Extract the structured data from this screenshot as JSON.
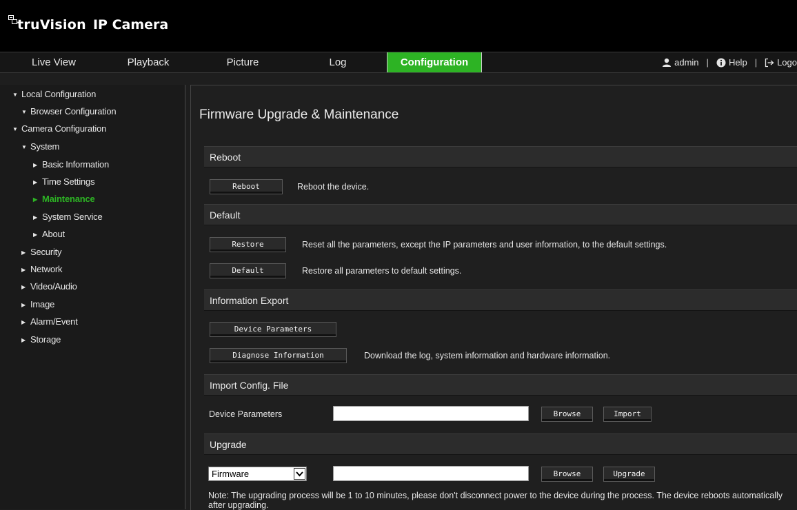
{
  "header": {
    "brand": "truVision",
    "product": "IP Camera"
  },
  "nav": {
    "tabs": [
      {
        "label": "Live View"
      },
      {
        "label": "Playback"
      },
      {
        "label": "Picture"
      },
      {
        "label": "Log"
      },
      {
        "label": "Configuration",
        "active": true
      }
    ],
    "user": "admin",
    "help": "Help",
    "logout": "Logo"
  },
  "sidebar": {
    "items": [
      {
        "label": "Local Configuration",
        "state": "expanded"
      },
      {
        "label": "Browser Configuration",
        "state": "expanded"
      },
      {
        "label": "Camera Configuration",
        "state": "expanded"
      },
      {
        "label": "System",
        "state": "expanded"
      },
      {
        "label": "Basic Information",
        "state": "collapsed"
      },
      {
        "label": "Time Settings",
        "state": "collapsed"
      },
      {
        "label": "Maintenance",
        "state": "collapsed",
        "selected": true
      },
      {
        "label": "System Service",
        "state": "collapsed"
      },
      {
        "label": "About",
        "state": "collapsed"
      },
      {
        "label": "Security",
        "state": "collapsed"
      },
      {
        "label": "Network",
        "state": "collapsed"
      },
      {
        "label": "Video/Audio",
        "state": "collapsed"
      },
      {
        "label": "Image",
        "state": "collapsed"
      },
      {
        "label": "Alarm/Event",
        "state": "collapsed"
      },
      {
        "label": "Storage",
        "state": "collapsed"
      }
    ]
  },
  "main": {
    "title": "Firmware Upgrade & Maintenance",
    "reboot": {
      "header": "Reboot",
      "button": "Reboot",
      "desc": "Reboot the device."
    },
    "default": {
      "header": "Default",
      "restore_button": "Restore",
      "restore_desc": "Reset all the parameters, except the IP parameters and user information, to the default settings.",
      "default_button": "Default",
      "default_desc": "Restore all parameters to default settings."
    },
    "export": {
      "header": "Information Export",
      "device_params_button": "Device Parameters",
      "diagnose_button": "Diagnose Information",
      "diagnose_desc": "Download the log, system information and hardware information."
    },
    "import": {
      "header": "Import Config. File",
      "label": "Device Parameters",
      "file_value": "",
      "browse_button": "Browse",
      "import_button": "Import"
    },
    "upgrade": {
      "header": "Upgrade",
      "type_value": "Firmware",
      "file_value": "",
      "browse_button": "Browse",
      "upgrade_button": "Upgrade",
      "note": "Note: The upgrading process will be 1 to 10 minutes, please don't disconnect power to the device during the process. The device reboots automatically after upgrading."
    }
  },
  "colors": {
    "accent": "#2db324",
    "background": "#1e1e1e",
    "header": "#000000"
  }
}
